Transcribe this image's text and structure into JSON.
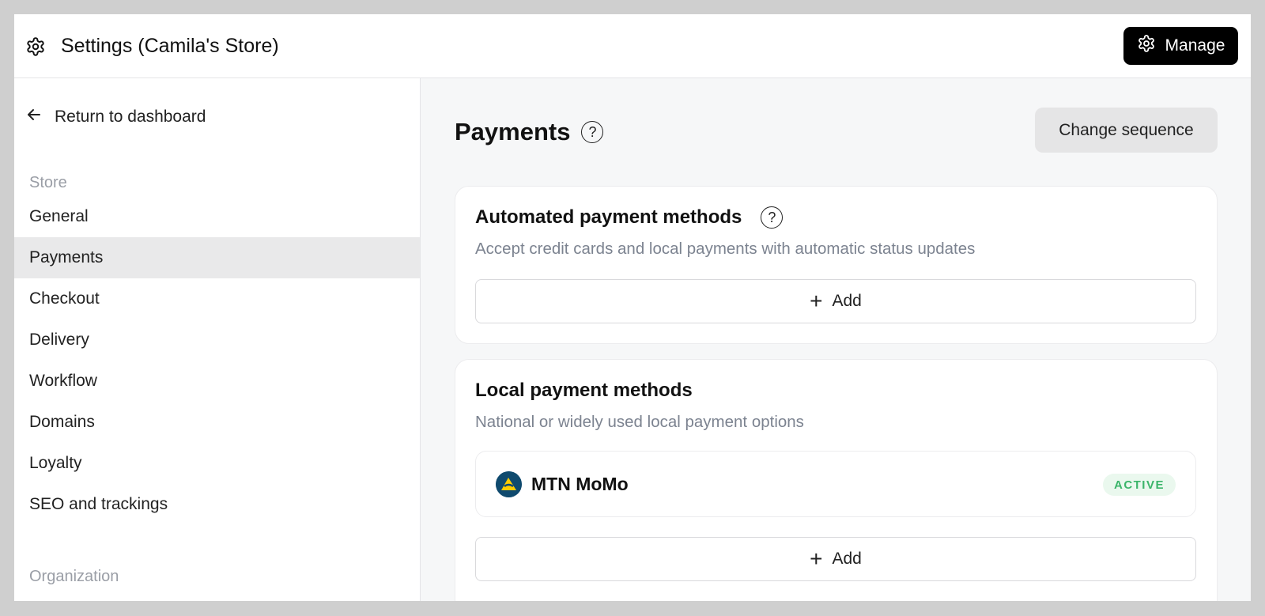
{
  "header": {
    "title": "Settings (Camila's Store)",
    "manage_label": "Manage"
  },
  "sidebar": {
    "back_label": "Return to dashboard",
    "store_section": "Store",
    "items": [
      {
        "label": "General"
      },
      {
        "label": "Payments",
        "active": true
      },
      {
        "label": "Checkout"
      },
      {
        "label": "Delivery"
      },
      {
        "label": "Workflow"
      },
      {
        "label": "Domains"
      },
      {
        "label": "Loyalty"
      },
      {
        "label": "SEO and trackings"
      }
    ],
    "organization_section": "Organization"
  },
  "main": {
    "title": "Payments",
    "help_symbol": "?",
    "change_sequence_label": "Change sequence",
    "automated": {
      "title": "Automated payment methods",
      "description": "Accept credit cards and local payments with automatic status updates",
      "add_label": "Add"
    },
    "local": {
      "title": "Local payment methods",
      "description": "National or widely used local payment options",
      "methods": [
        {
          "name": "MTN MoMo",
          "status": "ACTIVE",
          "icon": "mtn-momo-logo"
        }
      ],
      "add_label": "Add"
    }
  },
  "colors": {
    "accent": "#000000",
    "active_badge_bg": "#eaf8ee",
    "active_badge_text": "#3bb56a",
    "sidebar_active_bg": "#e9e9ea",
    "main_bg": "#f6f7f8"
  }
}
